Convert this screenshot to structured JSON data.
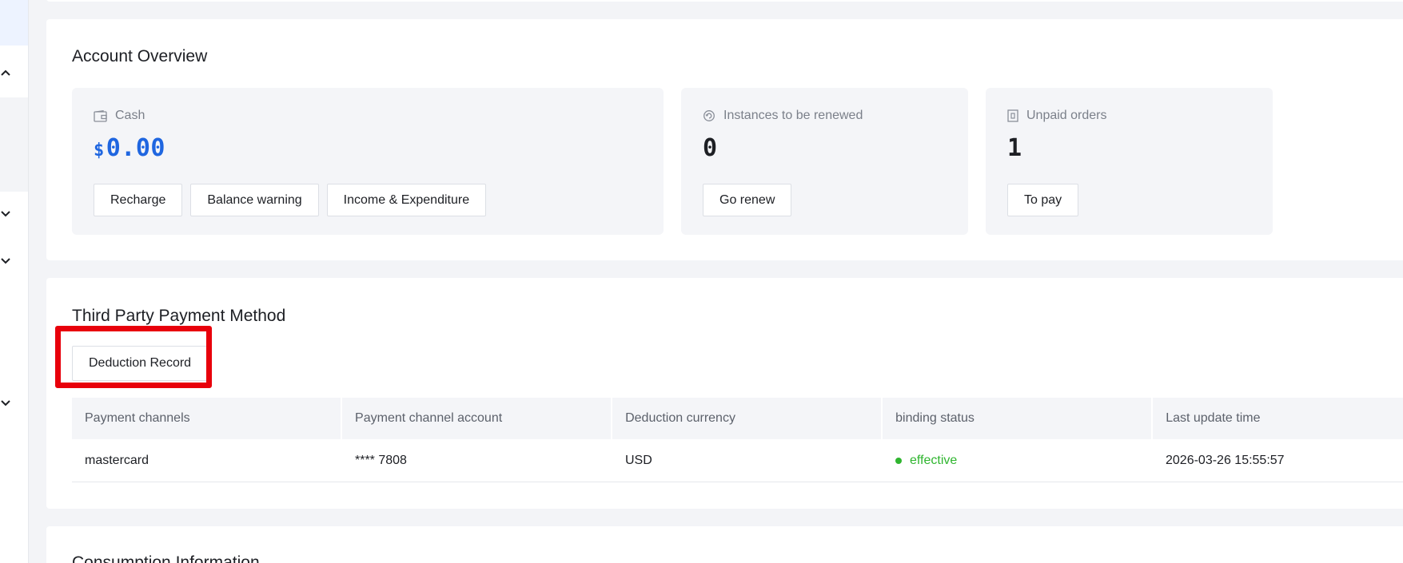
{
  "overview": {
    "title": "Account Overview",
    "cash": {
      "label": "Cash",
      "currency_symbol": "$",
      "value": "0.00",
      "buttons": [
        "Recharge",
        "Balance warning",
        "Income & Expenditure"
      ]
    },
    "renew": {
      "label": "Instances to be renewed",
      "value": "0",
      "button": "Go renew"
    },
    "unpaid": {
      "label": "Unpaid orders",
      "value": "1",
      "button": "To pay"
    }
  },
  "payment": {
    "title": "Third Party Payment Method",
    "deduction_button": "Deduction Record",
    "columns": [
      "Payment channels",
      "Payment channel account",
      "Deduction currency",
      "binding status",
      "Last update time"
    ],
    "rows": [
      {
        "channel": "mastercard",
        "account": "**** 7808",
        "currency": "USD",
        "status": "effective",
        "updated": "2026-03-26 15:55:57"
      }
    ]
  },
  "consumption": {
    "title": "Consumption Information"
  },
  "colors": {
    "accent": "#1f66e0",
    "status_effective": "#2fb52f",
    "highlight": "#e8000b"
  },
  "icons": {
    "cash": "wallet-icon",
    "renew": "renew-icon",
    "unpaid": "order-icon",
    "sidebar": "chevron-icon"
  }
}
